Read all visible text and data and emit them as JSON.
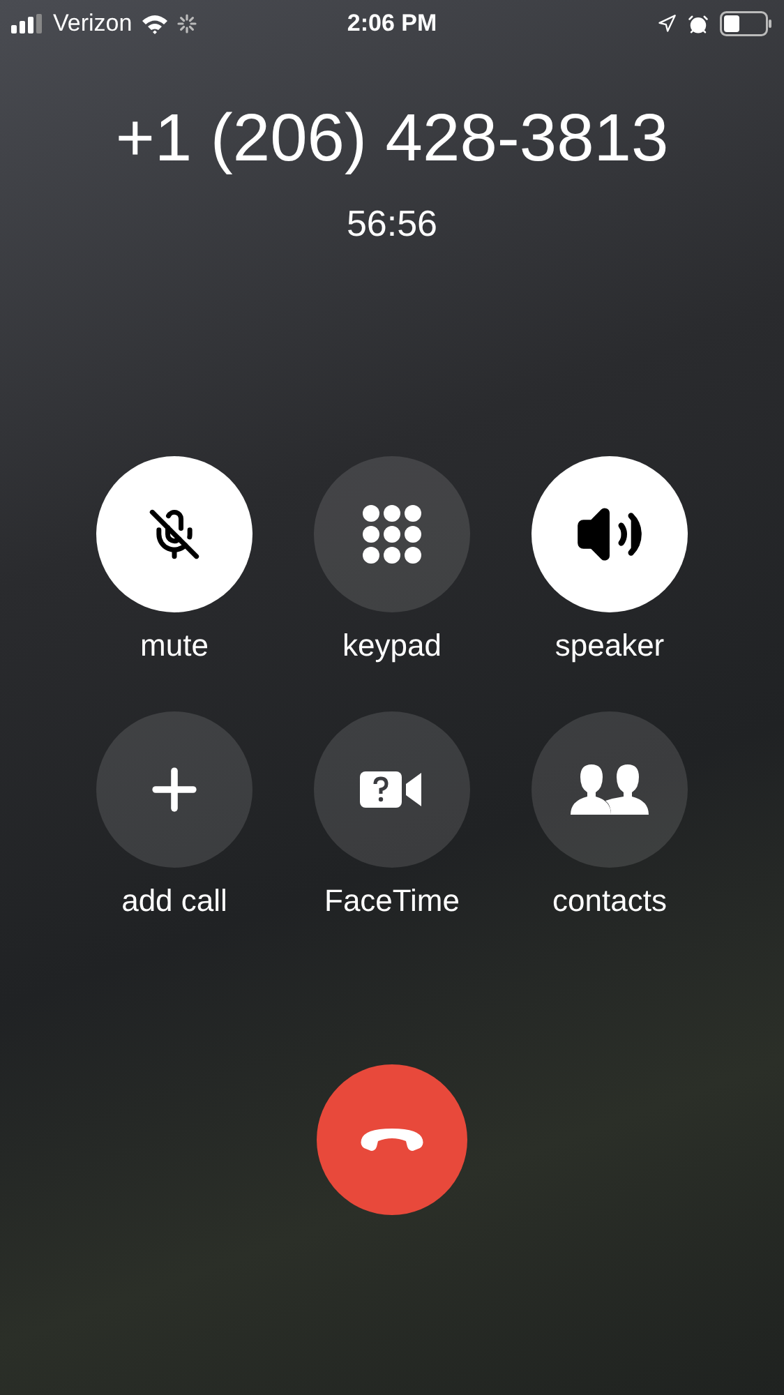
{
  "status_bar": {
    "carrier": "Verizon",
    "time": "2:06 PM"
  },
  "call": {
    "number": "+1 (206) 428-3813",
    "duration": "56:56"
  },
  "buttons": [
    {
      "kind": "mute",
      "label": "mute",
      "selected": true
    },
    {
      "kind": "keypad",
      "label": "keypad",
      "selected": false
    },
    {
      "kind": "speaker",
      "label": "speaker",
      "selected": true
    },
    {
      "kind": "add",
      "label": "add call",
      "selected": false
    },
    {
      "kind": "facetime",
      "label": "FaceTime",
      "selected": false
    },
    {
      "kind": "contacts",
      "label": "contacts",
      "selected": false
    }
  ]
}
